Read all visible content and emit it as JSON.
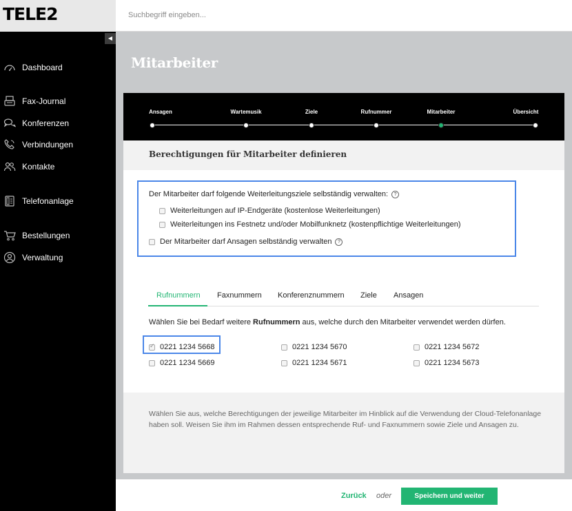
{
  "brand": {
    "logo_text": "TELE2"
  },
  "search": {
    "placeholder": "Suchbegriff eingeben..."
  },
  "sidebar": {
    "collapse_icon": "chevron-left",
    "items": [
      {
        "label": "Dashboard",
        "icon": "speedometer-icon"
      },
      {
        "label": "Fax-Journal",
        "icon": "fax-icon"
      },
      {
        "label": "Konferenzen",
        "icon": "chat-bubbles-icon"
      },
      {
        "label": "Verbindungen",
        "icon": "phone-icon"
      },
      {
        "label": "Kontakte",
        "icon": "people-icon"
      },
      {
        "label": "Telefonanlage",
        "icon": "phone-system-icon"
      },
      {
        "label": "Bestellungen",
        "icon": "cart-icon"
      },
      {
        "label": "Verwaltung",
        "icon": "user-circle-icon"
      }
    ]
  },
  "page": {
    "title": "Mitarbeiter"
  },
  "stepper": {
    "steps": [
      {
        "label": "Ansagen",
        "active": false
      },
      {
        "label": "Wartemusik",
        "active": false
      },
      {
        "label": "Ziele",
        "active": false
      },
      {
        "label": "Rufnummer",
        "active": false
      },
      {
        "label": "Mitarbeiter",
        "active": true
      },
      {
        "label": "Übersicht",
        "active": false
      }
    ]
  },
  "section": {
    "title": "Berechtigungen für Mitarbeiter definieren"
  },
  "permissions": {
    "forwarding_intro": "Der Mitarbeiter darf folgende Weiterleitungsziele selbständig verwalten:",
    "option_ip": "Weiterleitungen auf IP-Endgeräte (kostenlose Weiterleitungen)",
    "option_fixed": "Weiterleitungen ins Festnetz und/oder Mobilfunknetz (kostenpflichtige Weiterleitungen)",
    "announcements": "Der Mitarbeiter darf Ansagen selbständig verwalten",
    "help_symbol": "?"
  },
  "tabs": {
    "items": [
      "Rufnummern",
      "Faxnummern",
      "Konferenznummern",
      "Ziele",
      "Ansagen"
    ],
    "active": "Rufnummern"
  },
  "numbers_hint": {
    "prefix": "Wählen Sie bei Bedarf weitere ",
    "bold": "Rufnummern",
    "suffix": " aus, welche durch den Mitarbeiter verwendet werden dürfen."
  },
  "numbers": [
    {
      "value": "0221 1234 5668",
      "checked": true
    },
    {
      "value": "0221 1234 5669",
      "checked": false
    },
    {
      "value": "0221 1234 5670",
      "checked": false
    },
    {
      "value": "0221 1234 5671",
      "checked": false
    },
    {
      "value": "0221 1234 5672",
      "checked": false
    },
    {
      "value": "0221 1234 5673",
      "checked": false
    }
  ],
  "info": {
    "text": "Wählen Sie aus, welche Berechtigungen der jeweilige Mitarbeiter im Hinblick auf die Verwendung der Cloud-Telefonanlage haben soll. Weisen Sie ihm im Rahmen dessen entsprechende Ruf- und Faxnummern sowie Ziele und Ansagen zu."
  },
  "footer": {
    "back_label": "Zurück",
    "or_label": "oder",
    "save_label": "Speichern und weiter"
  },
  "colors": {
    "accent": "#22b573",
    "highlight": "#4a86e8",
    "sidebar_bg": "#000000",
    "content_bg": "#c7c9cb"
  }
}
